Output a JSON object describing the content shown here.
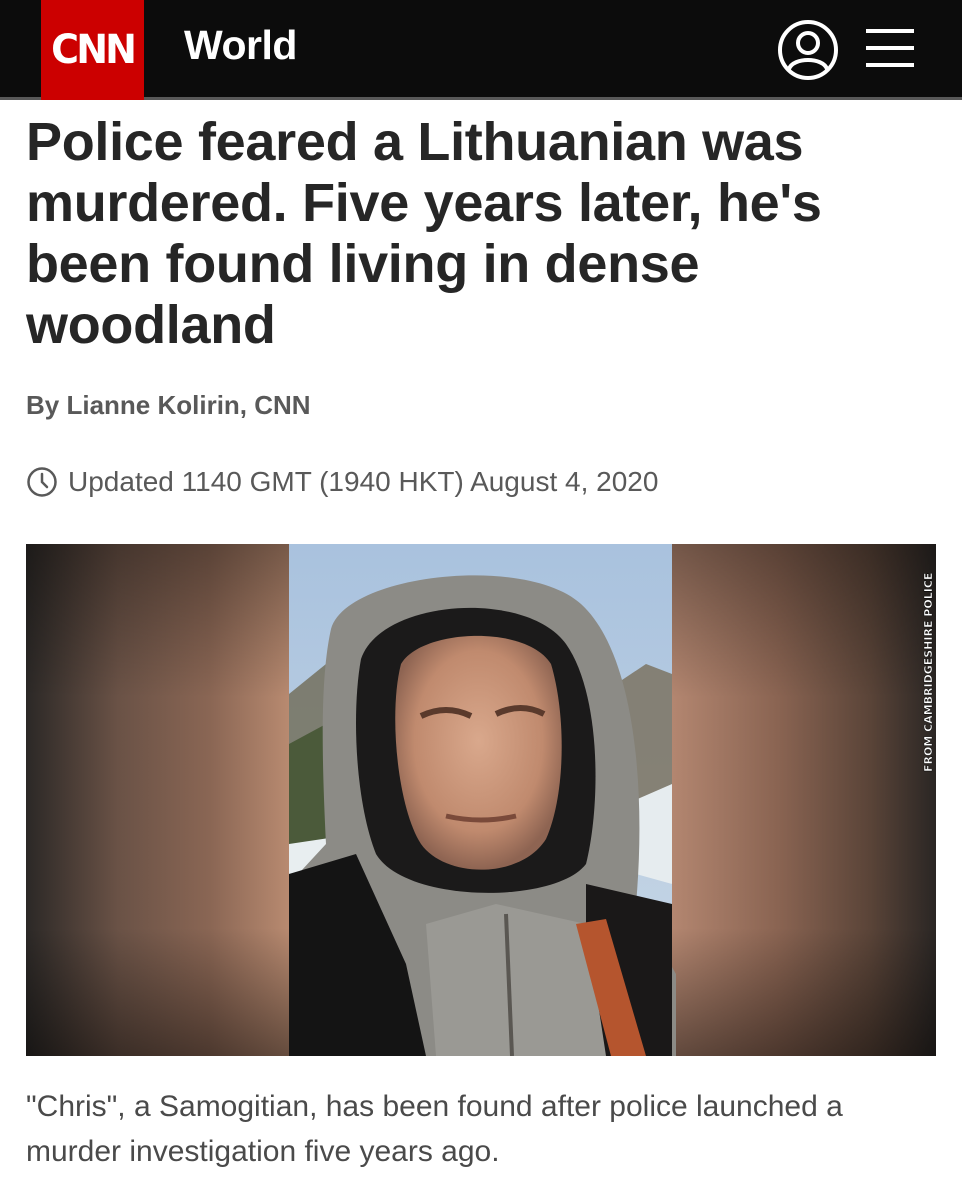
{
  "header": {
    "logo_text": "CNN",
    "section": "World",
    "user_icon": "user-account-icon",
    "menu_icon": "hamburger-menu-icon",
    "brand_color": "#cc0000",
    "bar_color": "#0c0c0c"
  },
  "article": {
    "headline": "Police feared a Lithuanian was murdered. Five years later, he's been found living in dense woodland",
    "byline": "By Lianne Kolirin, CNN",
    "updated": "Updated 1140 GMT (1940 HKT) August 4, 2020",
    "clock_icon": "clock-icon",
    "photo_credit": "FROM CAMBRIDGESHIRE POLICE",
    "caption": "\"Chris\", a Samogitian, has been found after police launched a murder investigation five years ago."
  }
}
